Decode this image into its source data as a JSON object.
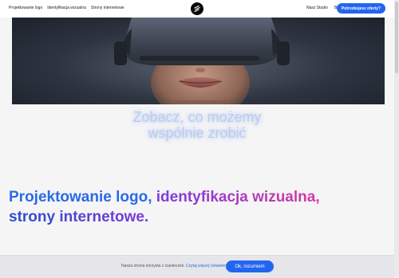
{
  "nav": {
    "left_items": [
      "Projektowanie logo",
      "Identyfikacja wizualna",
      "Strony internetowe"
    ],
    "right_items": [
      "Nasz Studio",
      "Blog"
    ],
    "cta_label": "Potrzebujesz oferty?"
  },
  "hero": {
    "image_alt_icon": "vr-headset-portrait-image",
    "headline_line1": "Zobacz, co możemy",
    "headline_line2": "wspólnie zrobić"
  },
  "tagline": {
    "part1": "Projektowanie logo,",
    "part2": "identyfikacja wizualna,",
    "part3": "strony internetowe."
  },
  "cookie_bar": {
    "text": "Nasza strona korzysta z ciasteczek.",
    "link_label": "Czytaj więcej Ustawienia ⌄",
    "accept_label": "Ok, rozumiem"
  },
  "colors": {
    "accent": "#2465f0",
    "headline": "#b9cdf3",
    "tagline_blue": "#2b6ae6",
    "tagline_purple": "#7a3cdc"
  }
}
